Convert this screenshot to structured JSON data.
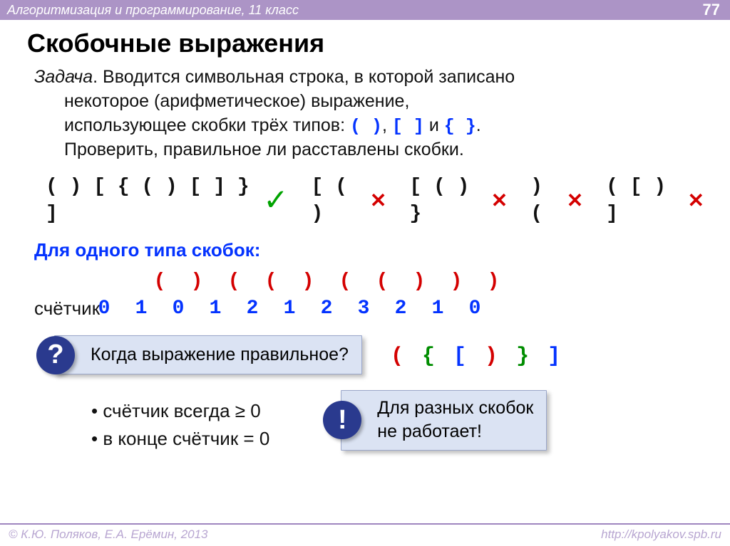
{
  "header": {
    "title": "Алгоритмизация и программирование, 11 класс",
    "page": "77"
  },
  "title": "Скобочные выражения",
  "task": {
    "lead": "Задача",
    "text1": ". Вводится символьная строка, в которой записано",
    "text2": "некоторое (арифметическое) выражение,",
    "text3a": "использующее скобки трёх типов: ",
    "b1": "( )",
    "c1": ", ",
    "b2": "[ ]",
    "c2": " и ",
    "b3": "{ }",
    "c3": ".",
    "text4": "Проверить, правильное ли расставлены скобки."
  },
  "examples": {
    "valid": "( ) [ { ( ) [ ] } ]",
    "inv1": "[ ( )",
    "inv2": "[ ( ) }",
    "inv3": ") (",
    "inv4": "( [ ) ]"
  },
  "subhead": "Для одного типа скобок:",
  "counter": {
    "label": "счётчик",
    "symbols": [
      "(",
      ")",
      "(",
      "(",
      ")",
      "(",
      "(",
      ")",
      ")",
      ")"
    ],
    "values": [
      "0",
      "1",
      "0",
      "1",
      "2",
      "1",
      "2",
      "3",
      "2",
      "1",
      "0"
    ]
  },
  "q_callout": "Когда выражение правильное?",
  "mixed": {
    "p1": "(",
    "p2": "{",
    "p3": "[",
    "p4": ")",
    "p5": "}",
    "p6": "]"
  },
  "bullets": {
    "b1": "• счётчик всегда ≥ 0",
    "b2": "• в конце счётчик = 0"
  },
  "e_callout": {
    "l1": "Для разных скобок",
    "l2": "не работает!"
  },
  "footer": {
    "left": "© К.Ю. Поляков, Е.А. Ерёмин, 2013",
    "right": "http://kpolyakov.spb.ru"
  }
}
